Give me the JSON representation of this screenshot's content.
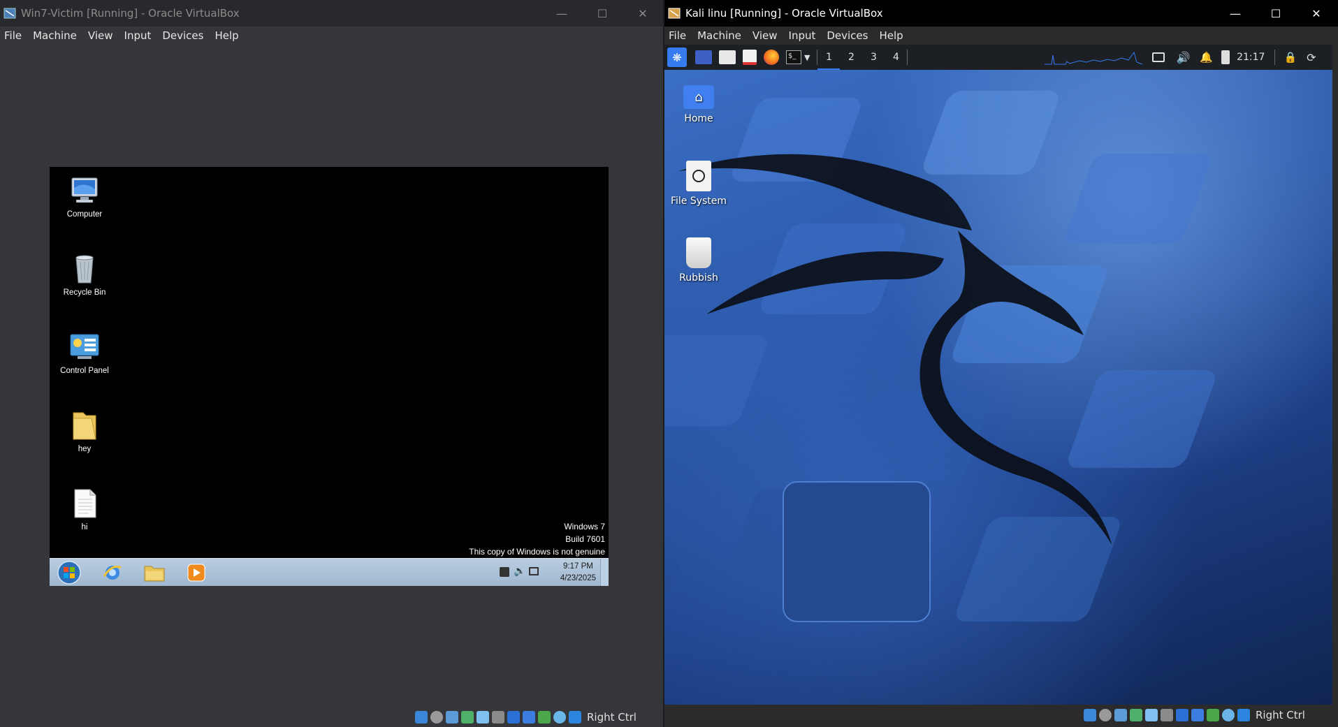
{
  "left_window": {
    "title": "Win7-Victim [Running] - Oracle VirtualBox",
    "menu": [
      "File",
      "Machine",
      "View",
      "Input",
      "Devices",
      "Help"
    ],
    "host_key": "Right Ctrl"
  },
  "win7": {
    "desktop_icons": [
      {
        "label": "Computer",
        "icon": "computer-icon"
      },
      {
        "label": "Recycle Bin",
        "icon": "recycle-bin-icon"
      },
      {
        "label": "Control Panel",
        "icon": "control-panel-icon"
      },
      {
        "label": "hey",
        "icon": "folder-icon"
      },
      {
        "label": "hi",
        "icon": "text-file-icon"
      }
    ],
    "watermark": [
      "Windows 7",
      "Build 7601",
      "This copy of Windows is not genuine"
    ],
    "clock_time": "9:17 PM",
    "clock_date": "4/23/2025"
  },
  "right_window": {
    "title": "Kali linu [Running] - Oracle VirtualBox",
    "menu": [
      "File",
      "Machine",
      "View",
      "Input",
      "Devices",
      "Help"
    ],
    "host_key": "Right Ctrl"
  },
  "kali": {
    "workspaces": [
      "1",
      "2",
      "3",
      "4"
    ],
    "clock": "21:17",
    "desktop_icons": [
      {
        "label": "Home",
        "icon": "home-folder-icon"
      },
      {
        "label": "File System",
        "icon": "drive-icon"
      },
      {
        "label": "Rubbish",
        "icon": "trash-icon"
      }
    ]
  },
  "colors": {
    "win7_taskbar": "#a9c0d8",
    "kali_panel": "#1c1f24",
    "kali_accent": "#367bf0"
  }
}
